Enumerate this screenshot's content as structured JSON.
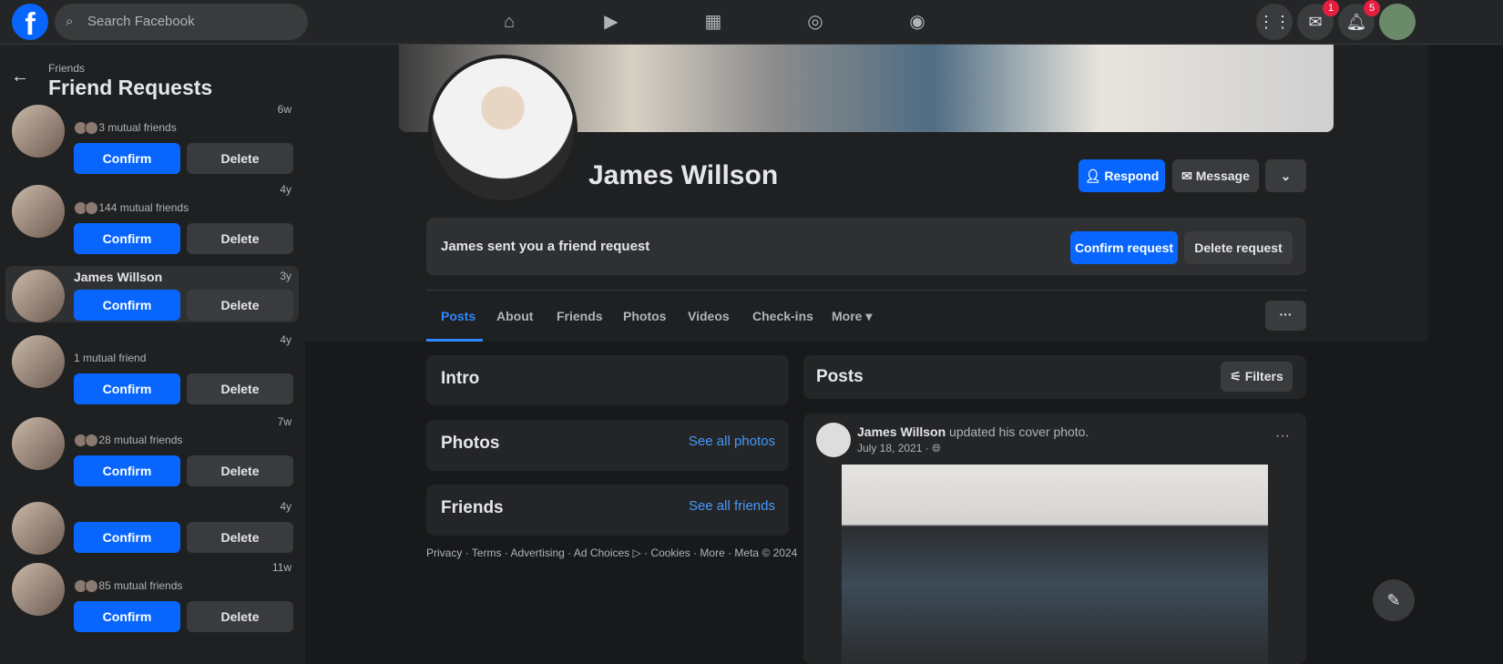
{
  "header": {
    "search_placeholder": "Search Facebook",
    "messenger_badge": "1",
    "notifications_badge": "5"
  },
  "sidebar": {
    "breadcrumb": "Friends",
    "title": "Friend Requests",
    "confirm": "Confirm",
    "delete": "Delete",
    "requests": [
      {
        "name": "",
        "time": "6w",
        "mutual": "3 mutual friends"
      },
      {
        "name": "",
        "time": "4y",
        "mutual": "144 mutual friends"
      },
      {
        "name": "James Willson",
        "time": "3y",
        "mutual": ""
      },
      {
        "name": "",
        "time": "4y",
        "mutual": "1 mutual friend"
      },
      {
        "name": "",
        "time": "7w",
        "mutual": "28 mutual friends"
      },
      {
        "name": "",
        "time": "4y",
        "mutual": ""
      },
      {
        "name": "",
        "time": "11w",
        "mutual": "85 mutual friends"
      }
    ]
  },
  "profile": {
    "name": "James Willson",
    "respond": "Respond",
    "message": "Message",
    "request_text": "James sent you a friend request",
    "confirm_request": "Confirm request",
    "delete_request": "Delete request"
  },
  "tabs": [
    "Posts",
    "About",
    "Friends",
    "Photos",
    "Videos",
    "Check-ins",
    "More ▾"
  ],
  "intro": {
    "title": "Intro"
  },
  "photos": {
    "title": "Photos",
    "link": "See all photos"
  },
  "friends": {
    "title": "Friends",
    "link": "See all friends"
  },
  "footer": "Privacy · Terms · Advertising · Ad Choices ▷ · Cookies · More · Meta © 2024",
  "posts": {
    "title": "Posts",
    "filters": "Filters",
    "author": "James Willson",
    "action": "updated his cover photo.",
    "date": "July 18, 2021 ·"
  }
}
